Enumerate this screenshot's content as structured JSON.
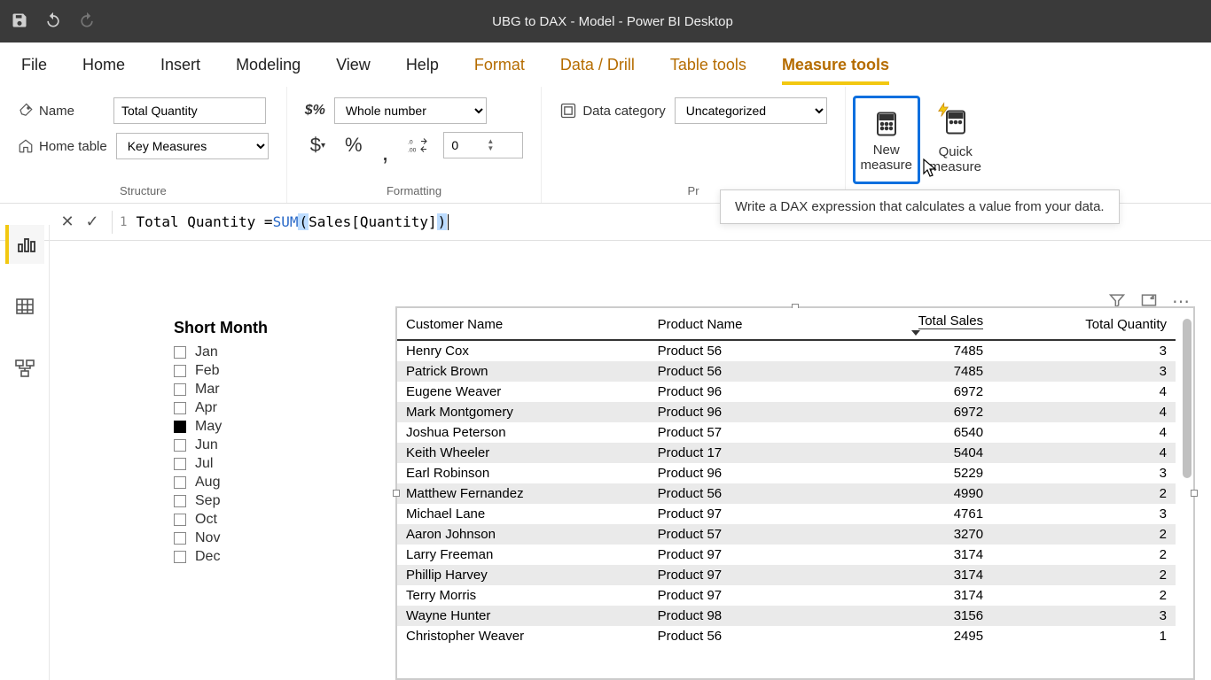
{
  "window_title": "UBG to DAX - Model - Power BI Desktop",
  "ribbon_tabs": [
    "File",
    "Home",
    "Insert",
    "Modeling",
    "View",
    "Help",
    "Format",
    "Data / Drill",
    "Table tools",
    "Measure tools"
  ],
  "active_tab_index": 9,
  "context_tab_start": 6,
  "structure": {
    "name_label": "Name",
    "name_value": "Total Quantity",
    "home_table_label": "Home table",
    "home_table_value": "Key Measures",
    "group_label": "Structure"
  },
  "formatting": {
    "format_value": "Whole number",
    "prefix_glyph": "$%",
    "dollar": "$",
    "percent": "%",
    "comma": ",",
    "decimals_icon": ".00→.0",
    "decimal_places": "0",
    "group_label": "Formatting"
  },
  "properties": {
    "data_category_label": "Data category",
    "data_category_value": "Uncategorized",
    "group_label": "Pr"
  },
  "calculations": {
    "new_measure_label_line1": "New",
    "new_measure_label_line2": "measure",
    "quick_measure_label_line1": "Quick",
    "quick_measure_label_line2": "measure",
    "tooltip": "Write a DAX expression that calculates a value from your data."
  },
  "formula": {
    "line_number": "1",
    "text_plain": "Total Quantity = SUM( Sales[Quantity] )",
    "parts": {
      "lhs": "Total Quantity = ",
      "func": "SUM",
      "open": "(",
      "arg": " Sales[Quantity] ",
      "close": ")"
    }
  },
  "slicer": {
    "title": "Short Month",
    "items": [
      {
        "label": "Jan",
        "checked": false
      },
      {
        "label": "Feb",
        "checked": false
      },
      {
        "label": "Mar",
        "checked": false
      },
      {
        "label": "Apr",
        "checked": false
      },
      {
        "label": "May",
        "checked": true
      },
      {
        "label": "Jun",
        "checked": false
      },
      {
        "label": "Jul",
        "checked": false
      },
      {
        "label": "Aug",
        "checked": false
      },
      {
        "label": "Sep",
        "checked": false
      },
      {
        "label": "Oct",
        "checked": false
      },
      {
        "label": "Nov",
        "checked": false
      },
      {
        "label": "Dec",
        "checked": false
      }
    ]
  },
  "table": {
    "headers": [
      "Customer Name",
      "Product Name",
      "Total Sales",
      "Total Quantity"
    ],
    "sorted_column_index": 2,
    "sort_direction": "desc",
    "numeric_columns": [
      2,
      3
    ],
    "rows": [
      [
        "Henry Cox",
        "Product 56",
        "7485",
        "3"
      ],
      [
        "Patrick Brown",
        "Product 56",
        "7485",
        "3"
      ],
      [
        "Eugene Weaver",
        "Product 96",
        "6972",
        "4"
      ],
      [
        "Mark Montgomery",
        "Product 96",
        "6972",
        "4"
      ],
      [
        "Joshua Peterson",
        "Product 57",
        "6540",
        "4"
      ],
      [
        "Keith Wheeler",
        "Product 17",
        "5404",
        "4"
      ],
      [
        "Earl Robinson",
        "Product 96",
        "5229",
        "3"
      ],
      [
        "Matthew Fernandez",
        "Product 56",
        "4990",
        "2"
      ],
      [
        "Michael Lane",
        "Product 97",
        "4761",
        "3"
      ],
      [
        "Aaron Johnson",
        "Product 57",
        "3270",
        "2"
      ],
      [
        "Larry Freeman",
        "Product 97",
        "3174",
        "2"
      ],
      [
        "Phillip Harvey",
        "Product 97",
        "3174",
        "2"
      ],
      [
        "Terry Morris",
        "Product 97",
        "3174",
        "2"
      ],
      [
        "Wayne Hunter",
        "Product 98",
        "3156",
        "3"
      ],
      [
        "Christopher Weaver",
        "Product 56",
        "2495",
        "1"
      ]
    ]
  }
}
